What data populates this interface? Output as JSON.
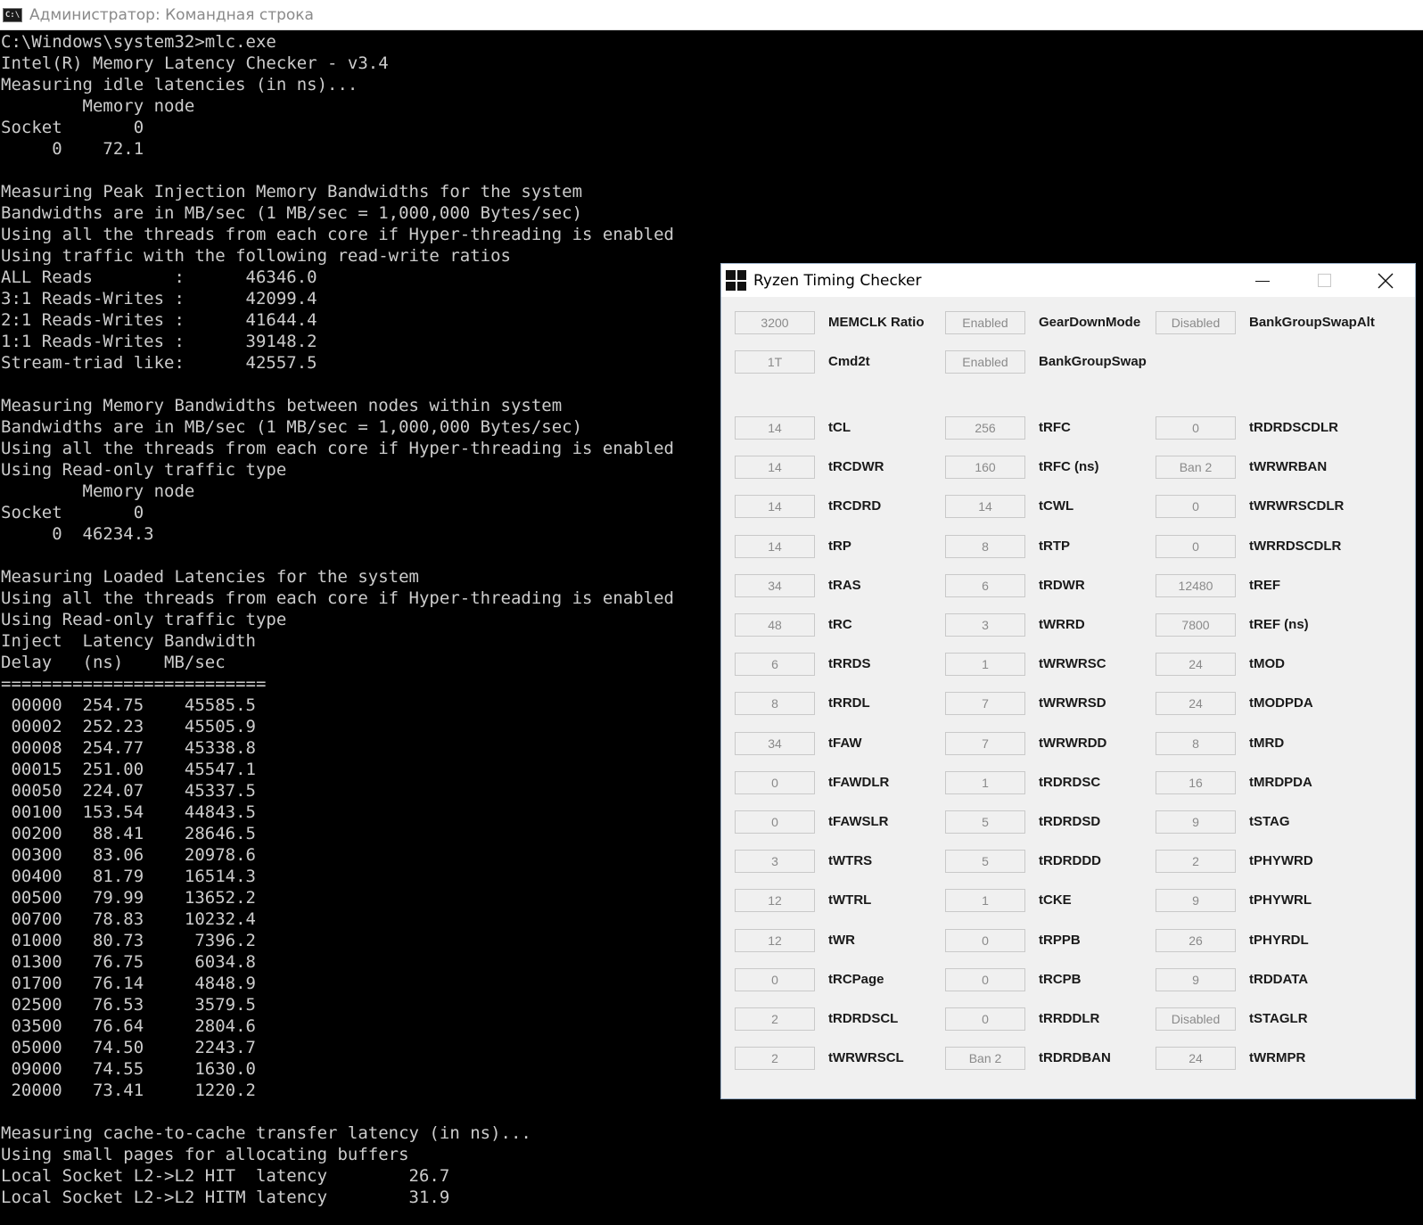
{
  "console": {
    "title": "Администратор: Командная строка",
    "icon_text": "C:\\",
    "lines": [
      "C:\\Windows\\system32>mlc.exe",
      "Intel(R) Memory Latency Checker - v3.4",
      "Measuring idle latencies (in ns)...",
      "        Memory node",
      "Socket       0",
      "     0    72.1",
      "",
      "Measuring Peak Injection Memory Bandwidths for the system",
      "Bandwidths are in MB/sec (1 MB/sec = 1,000,000 Bytes/sec)",
      "Using all the threads from each core if Hyper-threading is enabled",
      "Using traffic with the following read-write ratios",
      "ALL Reads        :      46346.0",
      "3:1 Reads-Writes :      42099.4",
      "2:1 Reads-Writes :      41644.4",
      "1:1 Reads-Writes :      39148.2",
      "Stream-triad like:      42557.5",
      "",
      "Measuring Memory Bandwidths between nodes within system",
      "Bandwidths are in MB/sec (1 MB/sec = 1,000,000 Bytes/sec)",
      "Using all the threads from each core if Hyper-threading is enabled",
      "Using Read-only traffic type",
      "        Memory node",
      "Socket       0",
      "     0  46234.3",
      "",
      "Measuring Loaded Latencies for the system",
      "Using all the threads from each core if Hyper-threading is enabled",
      "Using Read-only traffic type",
      "Inject  Latency Bandwidth",
      "Delay   (ns)    MB/sec",
      "==========================",
      " 00000  254.75    45585.5",
      " 00002  252.23    45505.9",
      " 00008  254.77    45338.8",
      " 00015  251.00    45547.1",
      " 00050  224.07    45337.5",
      " 00100  153.54    44843.5",
      " 00200   88.41    28646.5",
      " 00300   83.06    20978.6",
      " 00400   81.79    16514.3",
      " 00500   79.99    13652.2",
      " 00700   78.83    10232.4",
      " 01000   80.73     7396.2",
      " 01300   76.75     6034.8",
      " 01700   76.14     4848.9",
      " 02500   76.53     3579.5",
      " 03500   76.64     2804.6",
      " 05000   74.50     2243.7",
      " 09000   74.55     1630.0",
      " 20000   73.41     1220.2",
      "",
      "Measuring cache-to-cache transfer latency (in ns)...",
      "Using small pages for allocating buffers",
      "Local Socket L2->L2 HIT  latency        26.7",
      "Local Socket L2->L2 HITM latency        31.9"
    ]
  },
  "rtc": {
    "title": "Ryzen Timing Checker",
    "top_rows": [
      [
        {
          "value": "3200",
          "label": "MEMCLK Ratio"
        },
        {
          "value": "Enabled",
          "label": "GearDownMode"
        },
        {
          "value": "Disabled",
          "label": "BankGroupSwapAlt"
        }
      ],
      [
        {
          "value": "1T",
          "label": "Cmd2t"
        },
        {
          "value": "Enabled",
          "label": "BankGroupSwap"
        }
      ]
    ],
    "rows": [
      [
        {
          "value": "14",
          "label": "tCL"
        },
        {
          "value": "256",
          "label": "tRFC"
        },
        {
          "value": "0",
          "label": "tRDRDSCDLR"
        }
      ],
      [
        {
          "value": "14",
          "label": "tRCDWR"
        },
        {
          "value": "160",
          "label": "tRFC (ns)"
        },
        {
          "value": "Ban 2",
          "label": "tWRWRBAN"
        }
      ],
      [
        {
          "value": "14",
          "label": "tRCDRD"
        },
        {
          "value": "14",
          "label": "tCWL"
        },
        {
          "value": "0",
          "label": "tWRWRSCDLR"
        }
      ],
      [
        {
          "value": "14",
          "label": "tRP"
        },
        {
          "value": "8",
          "label": "tRTP"
        },
        {
          "value": "0",
          "label": "tWRRDSCDLR"
        }
      ],
      [
        {
          "value": "34",
          "label": "tRAS"
        },
        {
          "value": "6",
          "label": "tRDWR"
        },
        {
          "value": "12480",
          "label": "tREF"
        }
      ],
      [
        {
          "value": "48",
          "label": "tRC"
        },
        {
          "value": "3",
          "label": "tWRRD"
        },
        {
          "value": "7800",
          "label": "tREF (ns)"
        }
      ],
      [
        {
          "value": "6",
          "label": "tRRDS"
        },
        {
          "value": "1",
          "label": "tWRWRSC"
        },
        {
          "value": "24",
          "label": "tMOD"
        }
      ],
      [
        {
          "value": "8",
          "label": "tRRDL"
        },
        {
          "value": "7",
          "label": "tWRWRSD"
        },
        {
          "value": "24",
          "label": "tMODPDA"
        }
      ],
      [
        {
          "value": "34",
          "label": "tFAW"
        },
        {
          "value": "7",
          "label": "tWRWRDD"
        },
        {
          "value": "8",
          "label": "tMRD"
        }
      ],
      [
        {
          "value": "0",
          "label": "tFAWDLR"
        },
        {
          "value": "1",
          "label": "tRDRDSC"
        },
        {
          "value": "16",
          "label": "tMRDPDA"
        }
      ],
      [
        {
          "value": "0",
          "label": "tFAWSLR"
        },
        {
          "value": "5",
          "label": "tRDRDSD"
        },
        {
          "value": "9",
          "label": "tSTAG"
        }
      ],
      [
        {
          "value": "3",
          "label": "tWTRS"
        },
        {
          "value": "5",
          "label": "tRDRDDD"
        },
        {
          "value": "2",
          "label": "tPHYWRD"
        }
      ],
      [
        {
          "value": "12",
          "label": "tWTRL"
        },
        {
          "value": "1",
          "label": "tCKE"
        },
        {
          "value": "9",
          "label": "tPHYWRL"
        }
      ],
      [
        {
          "value": "12",
          "label": "tWR"
        },
        {
          "value": "0",
          "label": "tRPPB"
        },
        {
          "value": "26",
          "label": "tPHYRDL"
        }
      ],
      [
        {
          "value": "0",
          "label": "tRCPage"
        },
        {
          "value": "0",
          "label": "tRCPB"
        },
        {
          "value": "9",
          "label": "tRDDATA"
        }
      ],
      [
        {
          "value": "2",
          "label": "tRDRDSCL"
        },
        {
          "value": "0",
          "label": "tRRDDLR"
        },
        {
          "value": "Disabled",
          "label": "tSTAGLR"
        }
      ],
      [
        {
          "value": "2",
          "label": "tWRWRSCL"
        },
        {
          "value": "Ban 2",
          "label": "tRDRDBAN"
        },
        {
          "value": "24",
          "label": "tWRMPR"
        }
      ]
    ]
  }
}
